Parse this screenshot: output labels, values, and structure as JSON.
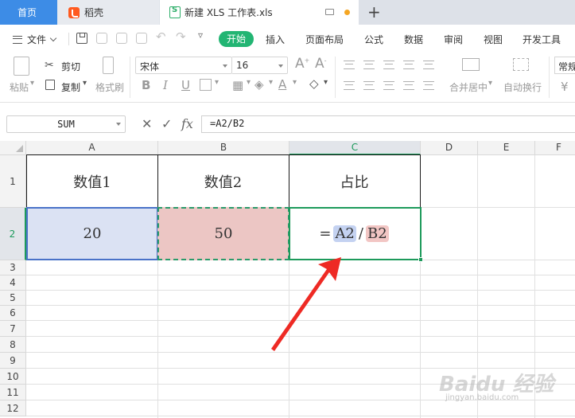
{
  "tabs": {
    "home": "首页",
    "docer": "稻壳",
    "file": "新建 XLS 工作表.xls"
  },
  "menu": {
    "file": "文件",
    "start": "开始",
    "insert": "插入",
    "page_layout": "页面布局",
    "formula": "公式",
    "data": "数据",
    "review": "审阅",
    "view": "视图",
    "developer": "开发工具"
  },
  "ribbon": {
    "paste": "粘贴",
    "cut": "剪切",
    "copy": "复制",
    "format_painter": "格式刷",
    "font_name": "宋体",
    "font_size": "16",
    "merge_center": "合并居中",
    "wrap_text": "自动换行",
    "number_format": "常规",
    "currency_symbol": "¥"
  },
  "formula_bar": {
    "name_box": "SUM",
    "fx_label": "fx",
    "formula": "=A2/B2"
  },
  "columns": [
    "A",
    "B",
    "C",
    "D",
    "E",
    "F"
  ],
  "rows": [
    "1",
    "2",
    "3",
    "4",
    "5",
    "6",
    "7",
    "8",
    "9",
    "10",
    "11",
    "12"
  ],
  "cells": {
    "A1": "数值1",
    "B1": "数值2",
    "C1": "占比",
    "A2": "20",
    "B2": "50",
    "C2": {
      "eq": "=",
      "ref1": "A2",
      "op": "/",
      "ref2": "B2"
    }
  },
  "colors": {
    "accent_green": "#1d9a5b",
    "start_button": "#22b573",
    "ref_a_highlight": "#c4d2f1",
    "ref_b_highlight": "#f2c6c4",
    "arrow": "#ee2a24"
  },
  "watermark": {
    "main": "Baidu 经验",
    "sub": "jingyan.baidu.com"
  }
}
